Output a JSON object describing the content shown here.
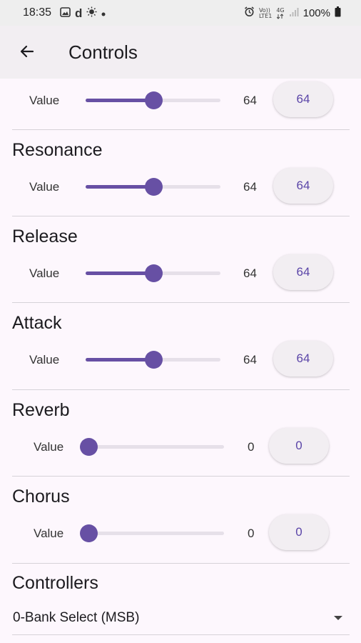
{
  "status_bar": {
    "time": "18:35",
    "left_icons": [
      "gallery-icon",
      "d-app-icon",
      "brightness-icon",
      "dot-icon"
    ],
    "net_top": "Vo))",
    "net_bottom": "LTE1",
    "gen_top": "4G",
    "battery": "100%"
  },
  "app_bar": {
    "title": "Controls"
  },
  "controls": [
    {
      "title": "",
      "label": "Value",
      "value": 64,
      "max": 127,
      "display": "64",
      "button": "64"
    },
    {
      "title": "Resonance",
      "label": "Value",
      "value": 64,
      "max": 127,
      "display": "64",
      "button": "64"
    },
    {
      "title": "Release",
      "label": "Value",
      "value": 64,
      "max": 127,
      "display": "64",
      "button": "64"
    },
    {
      "title": "Attack",
      "label": "Value",
      "value": 64,
      "max": 127,
      "display": "64",
      "button": "64"
    },
    {
      "title": "Reverb",
      "label": "Value",
      "value": 0,
      "max": 127,
      "display": "0",
      "button": "0"
    },
    {
      "title": "Chorus",
      "label": "Value",
      "value": 0,
      "max": 127,
      "display": "0",
      "button": "0"
    }
  ],
  "controllers": {
    "title": "Controllers",
    "selected": "0-Bank Select (MSB)"
  },
  "colors": {
    "accent": "#6750A4",
    "track": "#E6E0E9",
    "background": "#FDF7FD"
  }
}
